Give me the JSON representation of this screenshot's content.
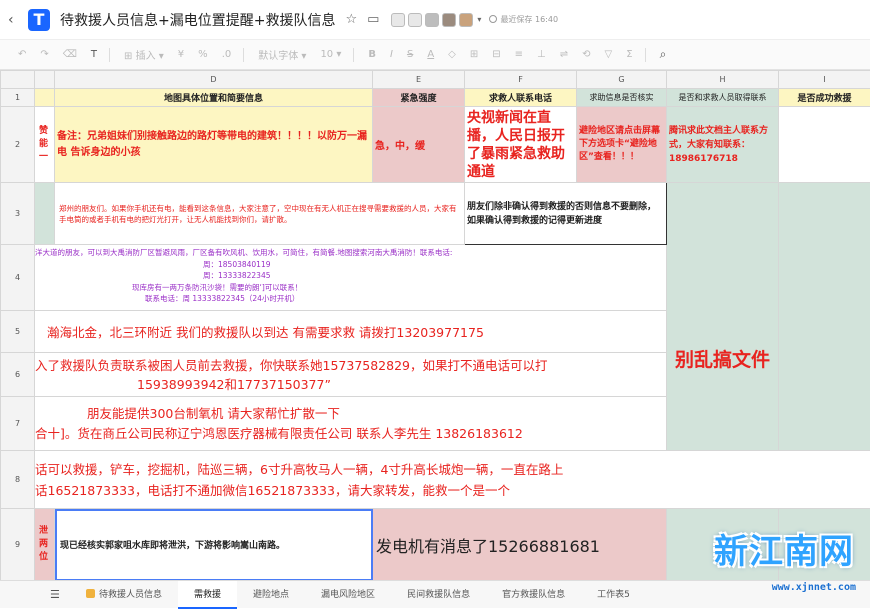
{
  "window": {
    "title": "待救援人员信息+漏电位置提醒+救援队信息",
    "saved": "最近保存 16:40"
  },
  "toolbar": {
    "insert": "插入",
    "font": "默认字体",
    "size": "10"
  },
  "columns": [
    "D",
    "E",
    "F",
    "G",
    "H",
    "I"
  ],
  "rows": {
    "numbers": [
      "1",
      "2",
      "3",
      "4",
      "5",
      "6",
      "7",
      "8",
      "9"
    ]
  },
  "cells": {
    "r1": {
      "d": "地图具体位置和简要信息",
      "e": "紧急强度",
      "f": "求救人联系电话",
      "g": "求助信息是否核实",
      "h": "是否和求救人员取得联系",
      "i": "是否成功救援"
    },
    "r2": {
      "c": "赞\n能\n一",
      "d": "备注：兄弟姐妹们别接触路边的路灯等带电的建筑！！！！以防万一漏电 告诉身边的小孩",
      "e": "急，中，缓",
      "f": "央视新闻在直播，人民日报开了暴雨紧急救助通道",
      "g": "避险地区请点击屏幕下方选项卡“避险地区”查看！！！",
      "h": "腾讯求此文档主人联系方式，大家有知联系：18986176718"
    },
    "r3": {
      "d": "郑州的朋友们。如果你手机还有电，能看到这条信息，大家注意了，空中现在有无人机正在搜寻需要救援的人员，大家有手电筒的或者手机有电的把灯光打开，让无人机能找到你们，请扩散。",
      "f": "朋友们除非确认得到救援的否则信息不要删除，如果确认得到救援的记得更新进度"
    },
    "r4": {
      "line1": "洋大道的朋友，可以到大禹消防厂区暂避风雨，厂区备有吹风机、饮用水，可简住，有简餐.地图搜索河南大禹消防！联系电话:",
      "line2": "周：18503840119",
      "line3": "周：13333822345",
      "line4": "现库房有一两万条防汛沙袋！需要的朗‘]可以联系！",
      "line5": "联系电话：周 13333822345（24小时开机）"
    },
    "r5": {
      "d": "瀚海北金，北三环附近 我们的救援队以到达 有需要求救 请拨打13203977175"
    },
    "r6": {
      "line1": "入了救援队负责联系被困人员前去救援，你快联系她15737582829，如果打不通电话可以打",
      "line2": "15938993942和17737150377”"
    },
    "r7": {
      "line1": "朋友能提供300台制氧机 请大家帮忙扩散一下",
      "line2": "合十]。货在商丘公司民称辽宁鸿恩医疗器械有限责任公司 联系人李先生 13826183612"
    },
    "r8": {
      "line1": "话可以救援，铲车，挖掘机，陆巡三辆，6寸升高牧马人一辆，4寸升高长城炮一辆，一直在路上",
      "line2": "话16521873333，电话打不通加微信16521873333，请大家转发，能救一个是一个"
    },
    "r9": {
      "c": "泄\n两\n位",
      "d": "现已经核实郭家咀水库即将泄洪，下游将影响嵩山南路。",
      "ef": "发电机有消息了15266881681"
    },
    "merged_h": "别乱搞文件"
  },
  "tabs": [
    "待救援人员信息",
    "需救援",
    "避险地点",
    "漏电风险地区",
    "民间救援队信息",
    "官方救援队信息",
    "工作表5"
  ],
  "active_tab": "需救援",
  "watermark": {
    "text": "新江南网",
    "url": "www.xjnnet.com"
  }
}
